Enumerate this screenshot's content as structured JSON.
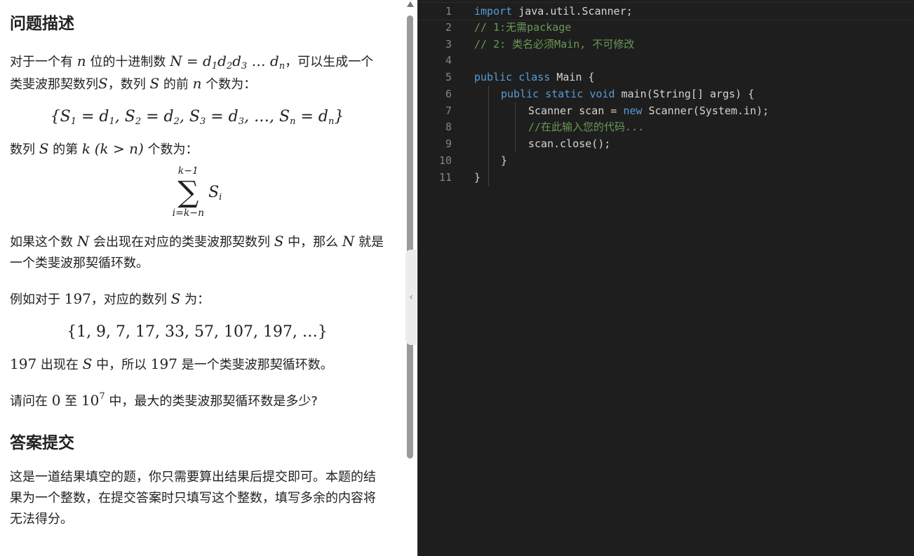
{
  "problem": {
    "heading": "问题描述",
    "p1": {
      "a": "对于一个有 ",
      "n": "n",
      "b": " 位的十进制数 ",
      "N": "N = d",
      "d1": "1",
      "d2s": "d",
      "d2": "2",
      "d3s": "d",
      "d3": "3",
      "dots": " … d",
      "dn": "n",
      "c": "，可以生成一个类斐波那契数列",
      "S": "S",
      "d": "，数列 ",
      "S2": "S",
      "e": " 的前 ",
      "n2": "n",
      "f": " 个数为："
    },
    "eq1": {
      "open": "{",
      "s1": "S",
      "i1": "1",
      "eq1": " = d",
      "j1": "1",
      "sep1": ", S",
      "i2": "2",
      "eq2": " = d",
      "j2": "2",
      "sep2": ", S",
      "i3": "3",
      "eq3": " = d",
      "j3": "3",
      "mid": ", …, S",
      "in": "n",
      "eqn": " = d",
      "jn": "n",
      "close": "}"
    },
    "p2": {
      "a": "数列 ",
      "S": "S",
      "b": " 的第 ",
      "k": "k",
      "c": "(k > n)",
      "d": " 个数为："
    },
    "sum": {
      "upper": "k−1",
      "sigma": "∑",
      "lower": "i=k−n",
      "term": "S",
      "sub": "i"
    },
    "p3": {
      "a": "如果这个数 ",
      "N": "N",
      "b": " 会出现在对应的类斐波那契数列 ",
      "S": "S",
      "c": " 中，那么 ",
      "N2": "N",
      "d": " 就是一个类斐波那契循环数。"
    },
    "p4": {
      "a": "例如对于 ",
      "num": "197",
      "b": "，对应的数列 ",
      "S": "S",
      "c": " 为："
    },
    "eq2": "{1, 9, 7, 17, 33, 57, 107, 197, …}",
    "p5": {
      "num": "197",
      "a": " 出现在 ",
      "S": "S",
      "b": " 中，所以 ",
      "num2": "197",
      "c": " 是一个类斐波那契循环数。"
    },
    "p6": {
      "a": "请问在 ",
      "zero": "0",
      "b": " 至 ",
      "ten": "10",
      "exp": "7",
      "c": " 中，最大的类斐波那契循环数是多少?"
    }
  },
  "answer": {
    "heading": "答案提交",
    "text": "这是一道结果填空的题，你只需要算出结果后提交即可。本题的结果为一个整数，在提交答案时只填写这个整数，填写多余的内容将无法得分。"
  },
  "editor": {
    "lines": [
      {
        "num": "1",
        "t1": "import",
        "t2": " java.util.Scanner;"
      },
      {
        "num": "2",
        "comment": "// 1:无需package"
      },
      {
        "num": "3",
        "comment": "// 2: 类名必须Main, 不可修改"
      },
      {
        "num": "4"
      },
      {
        "num": "5",
        "t1": "public",
        "t2": " ",
        "t3": "class",
        "t4": " Main {"
      },
      {
        "num": "6",
        "t1": "public",
        "t2": " ",
        "t3": "static",
        "t4": " ",
        "t5": "void",
        "t6": " main(String[] args) {"
      },
      {
        "num": "7",
        "t1": "Scanner scan = ",
        "t2": "new",
        "t3": " Scanner(System.in);"
      },
      {
        "num": "8",
        "comment": "//在此输入您的代码..."
      },
      {
        "num": "9",
        "text": "scan.close();"
      },
      {
        "num": "10",
        "text": "}"
      },
      {
        "num": "11",
        "text": "}"
      }
    ]
  },
  "colors": {
    "editor_bg": "#1e1e1e",
    "keyword": "#569cd6",
    "comment": "#6a9955",
    "text": "#d4d4d4",
    "line_number": "#858585"
  }
}
